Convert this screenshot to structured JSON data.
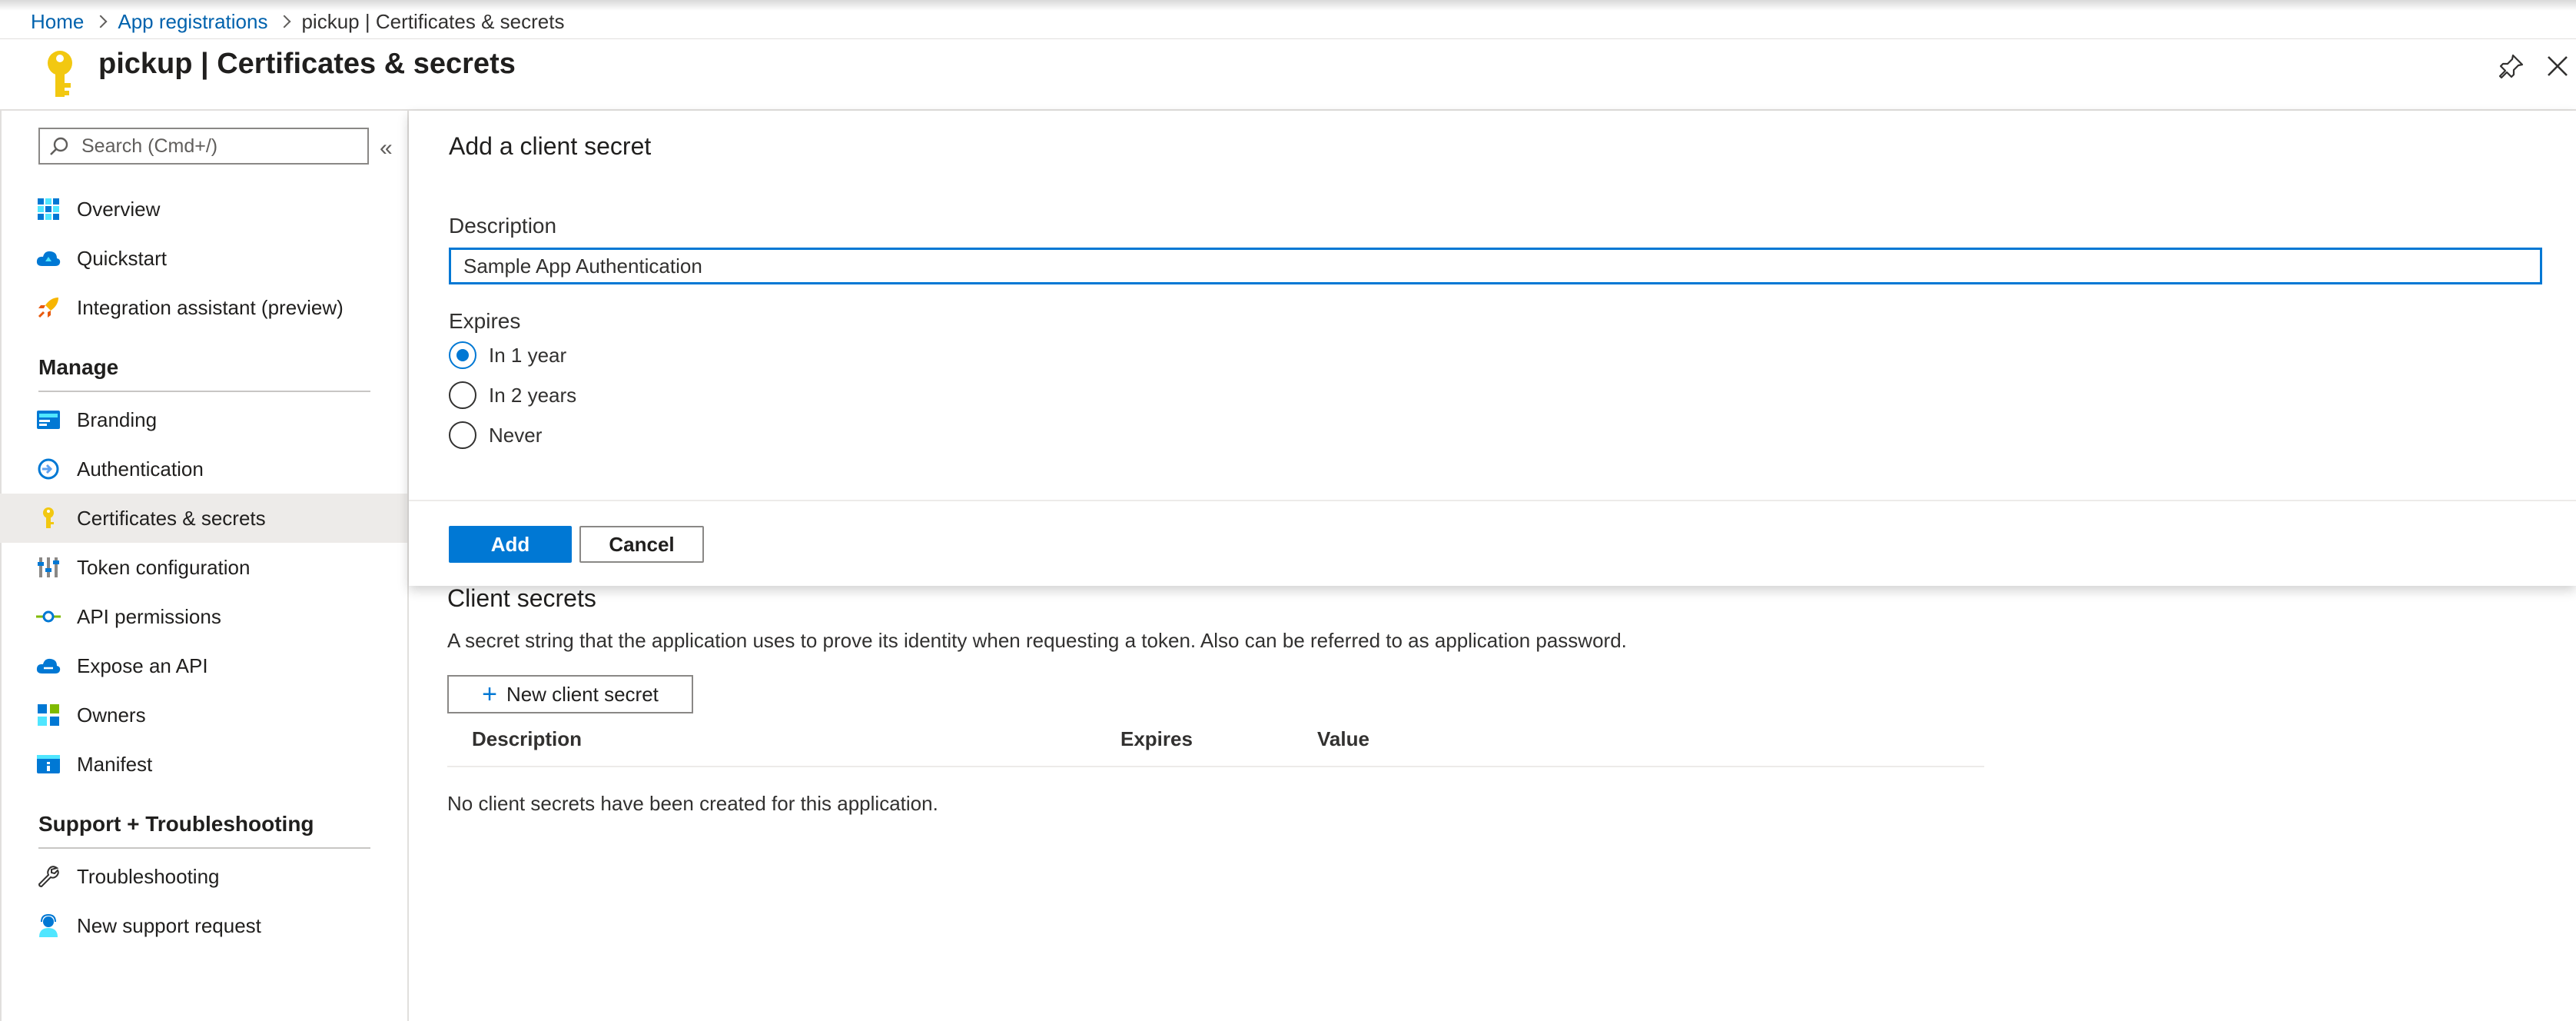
{
  "breadcrumb": {
    "items": [
      "Home",
      "App registrations"
    ],
    "current": "pickup | Certificates & secrets"
  },
  "page_title": "pickup | Certificates & secrets",
  "sidebar": {
    "search_placeholder": "Search (Cmd+/)",
    "collapse_glyph": "«",
    "top_items": [
      {
        "label": "Overview",
        "icon": "overview-grid-icon"
      },
      {
        "label": "Quickstart",
        "icon": "quickstart-cloud-icon"
      },
      {
        "label": "Integration assistant (preview)",
        "icon": "rocket-icon"
      }
    ],
    "manage_heading": "Manage",
    "manage_items": [
      {
        "label": "Branding",
        "icon": "branding-icon"
      },
      {
        "label": "Authentication",
        "icon": "authentication-icon"
      },
      {
        "label": "Certificates & secrets",
        "icon": "key-icon",
        "active": true
      },
      {
        "label": "Token configuration",
        "icon": "token-bars-icon"
      },
      {
        "label": "API permissions",
        "icon": "api-permissions-icon"
      },
      {
        "label": "Expose an API",
        "icon": "cloud-icon"
      },
      {
        "label": "Owners",
        "icon": "owners-grid-icon"
      },
      {
        "label": "Manifest",
        "icon": "manifest-icon"
      }
    ],
    "support_heading": "Support + Troubleshooting",
    "support_items": [
      {
        "label": "Troubleshooting",
        "icon": "wrench-icon"
      },
      {
        "label": "New support request",
        "icon": "support-person-icon"
      }
    ]
  },
  "dialog": {
    "title": "Add a client secret",
    "description_label": "Description",
    "description_value": "Sample App Authentication",
    "expires_label": "Expires",
    "options": [
      "In 1 year",
      "In 2 years",
      "Never"
    ],
    "selected_option": "In 1 year",
    "add_label": "Add",
    "cancel_label": "Cancel"
  },
  "client_secrets": {
    "title": "Client secrets",
    "description": "A secret string that the application uses to prove its identity when requesting a token. Also can be referred to as application password.",
    "new_button_label": "New client secret",
    "columns": [
      "Description",
      "Expires",
      "Value"
    ],
    "empty_text": "No client secrets have been created for this application."
  },
  "colors": {
    "accent": "#0078d4",
    "link": "#0062ad",
    "active_nav_bg": "#edebe9"
  }
}
